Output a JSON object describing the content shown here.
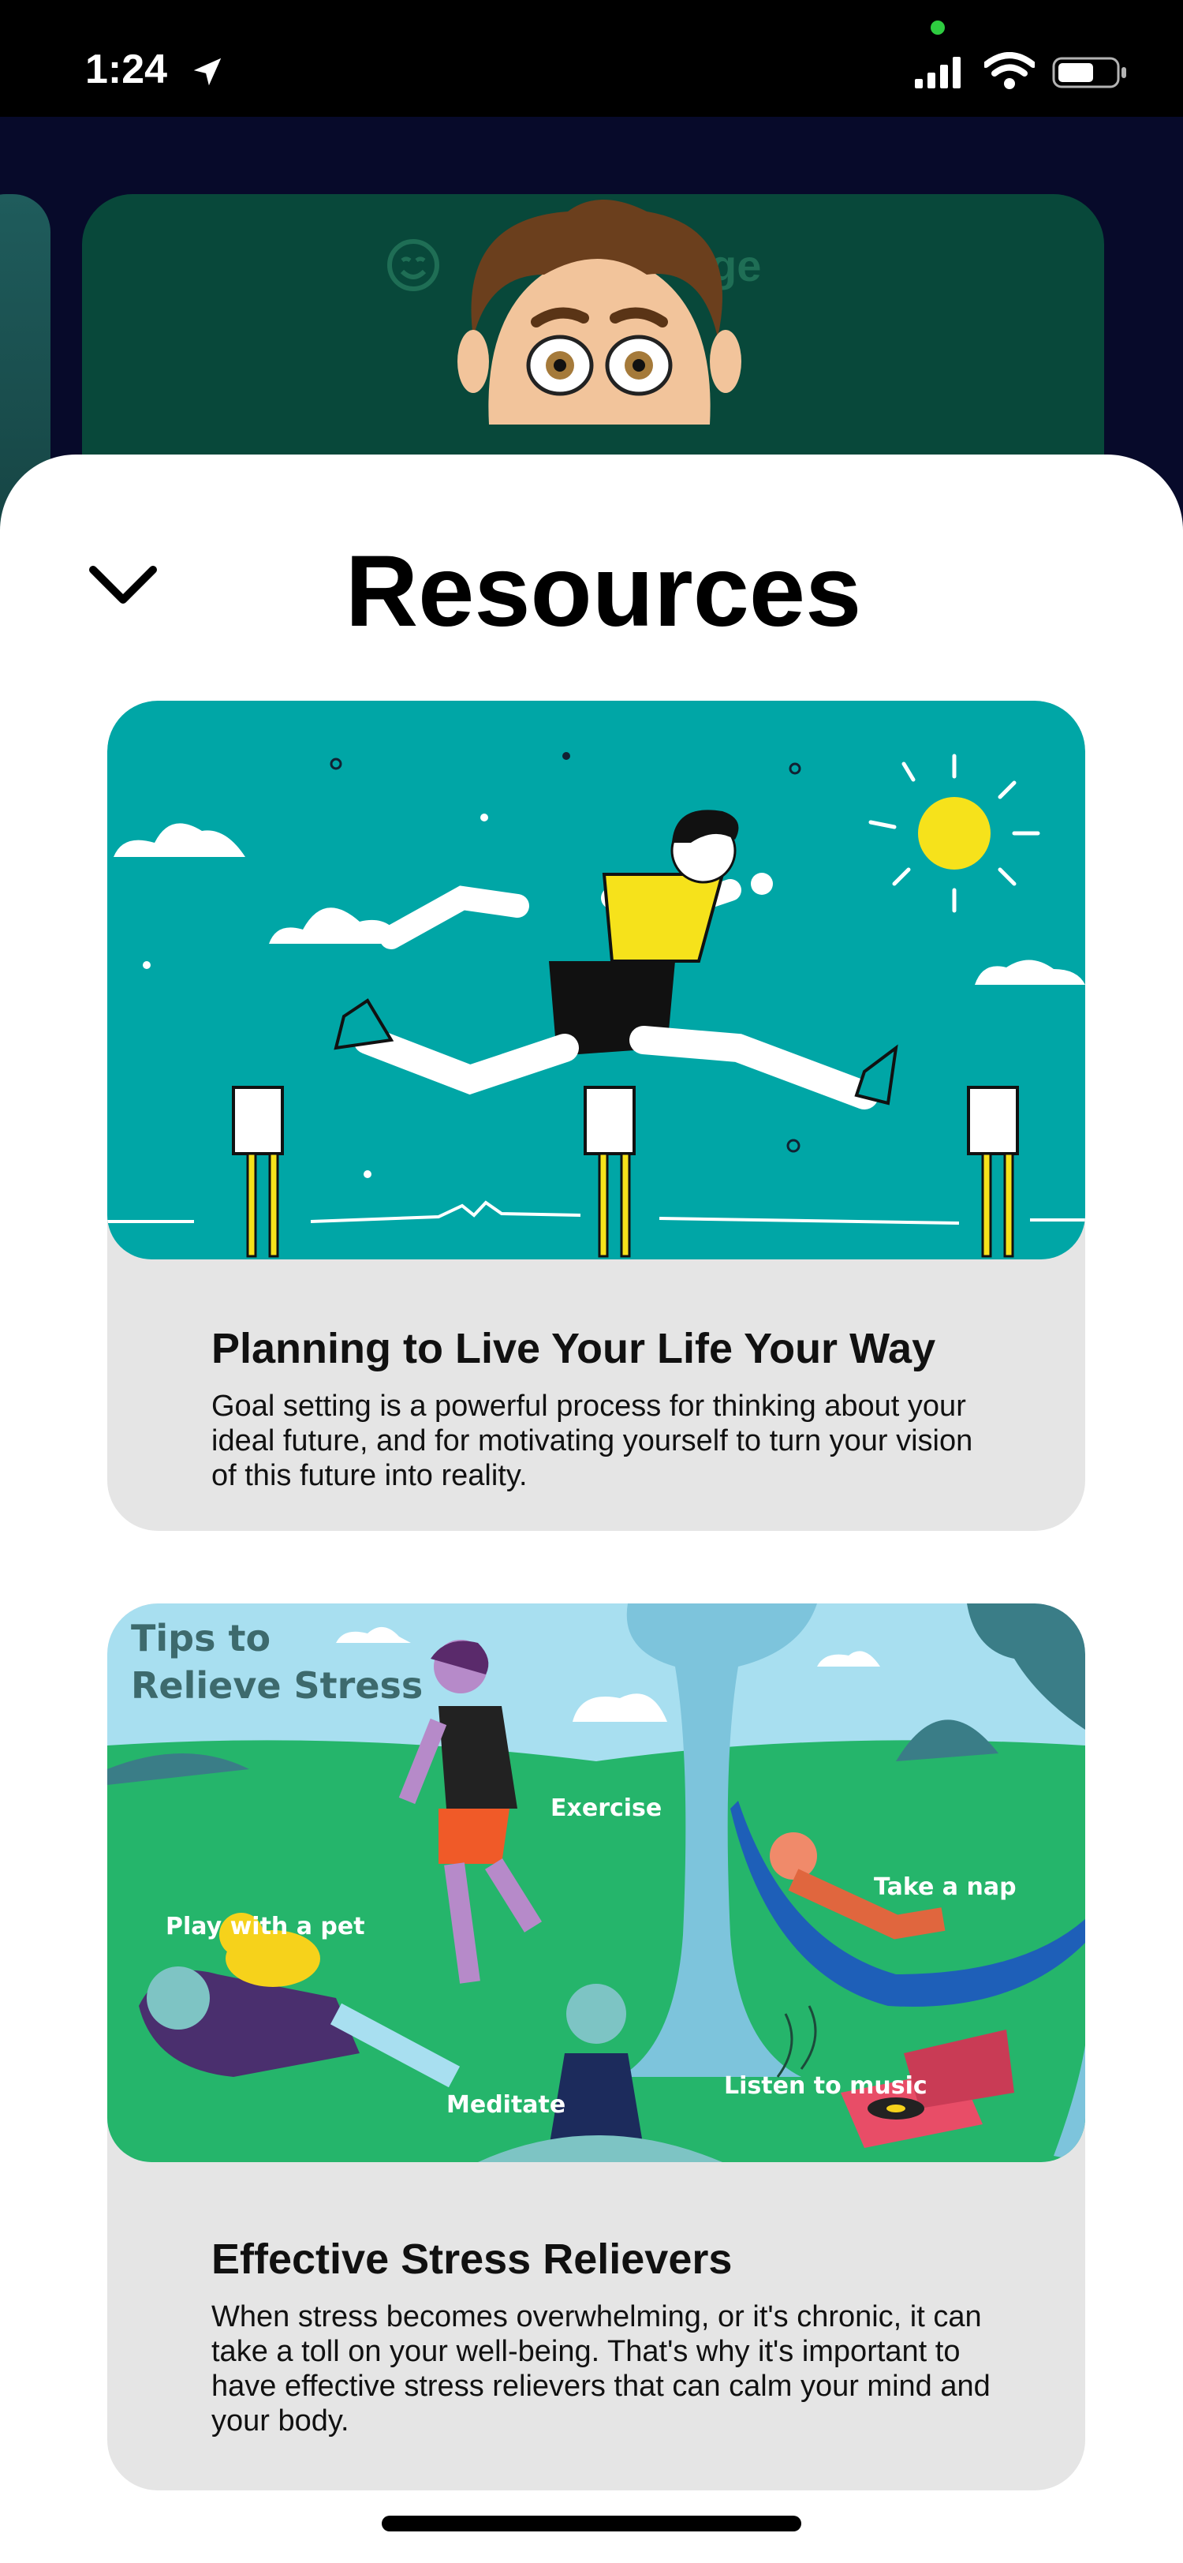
{
  "status_bar": {
    "time": "1:24"
  },
  "background_app": {
    "card_title": "ge"
  },
  "sheet": {
    "title": "Resources"
  },
  "resources": [
    {
      "title": "Planning to Live Your Life Your Way",
      "description": "Goal setting is a powerful process for thinking about your ideal future, and for motivating yourself to turn your vision of this future into reality."
    },
    {
      "title": "Effective Stress Relievers",
      "description": "When stress becomes overwhelming, or it's chronic, it can take a toll on your well-being. That's why it's important to have effective stress relievers that can calm your mind and your body.",
      "image_text": {
        "heading_line1": "Tips to",
        "heading_line2": "Relieve Stress",
        "exercise": "Exercise",
        "play_with_pet": "Play with a pet",
        "take_a_nap": "Take a nap",
        "meditate": "Meditate",
        "listen_to_music": "Listen to music"
      }
    }
  ],
  "colors": {
    "card1_bg": "#00a6a6",
    "card2_sky": "#a8dff0",
    "card2_grass": "#25b56b",
    "card_body": "#e5e5e5"
  }
}
